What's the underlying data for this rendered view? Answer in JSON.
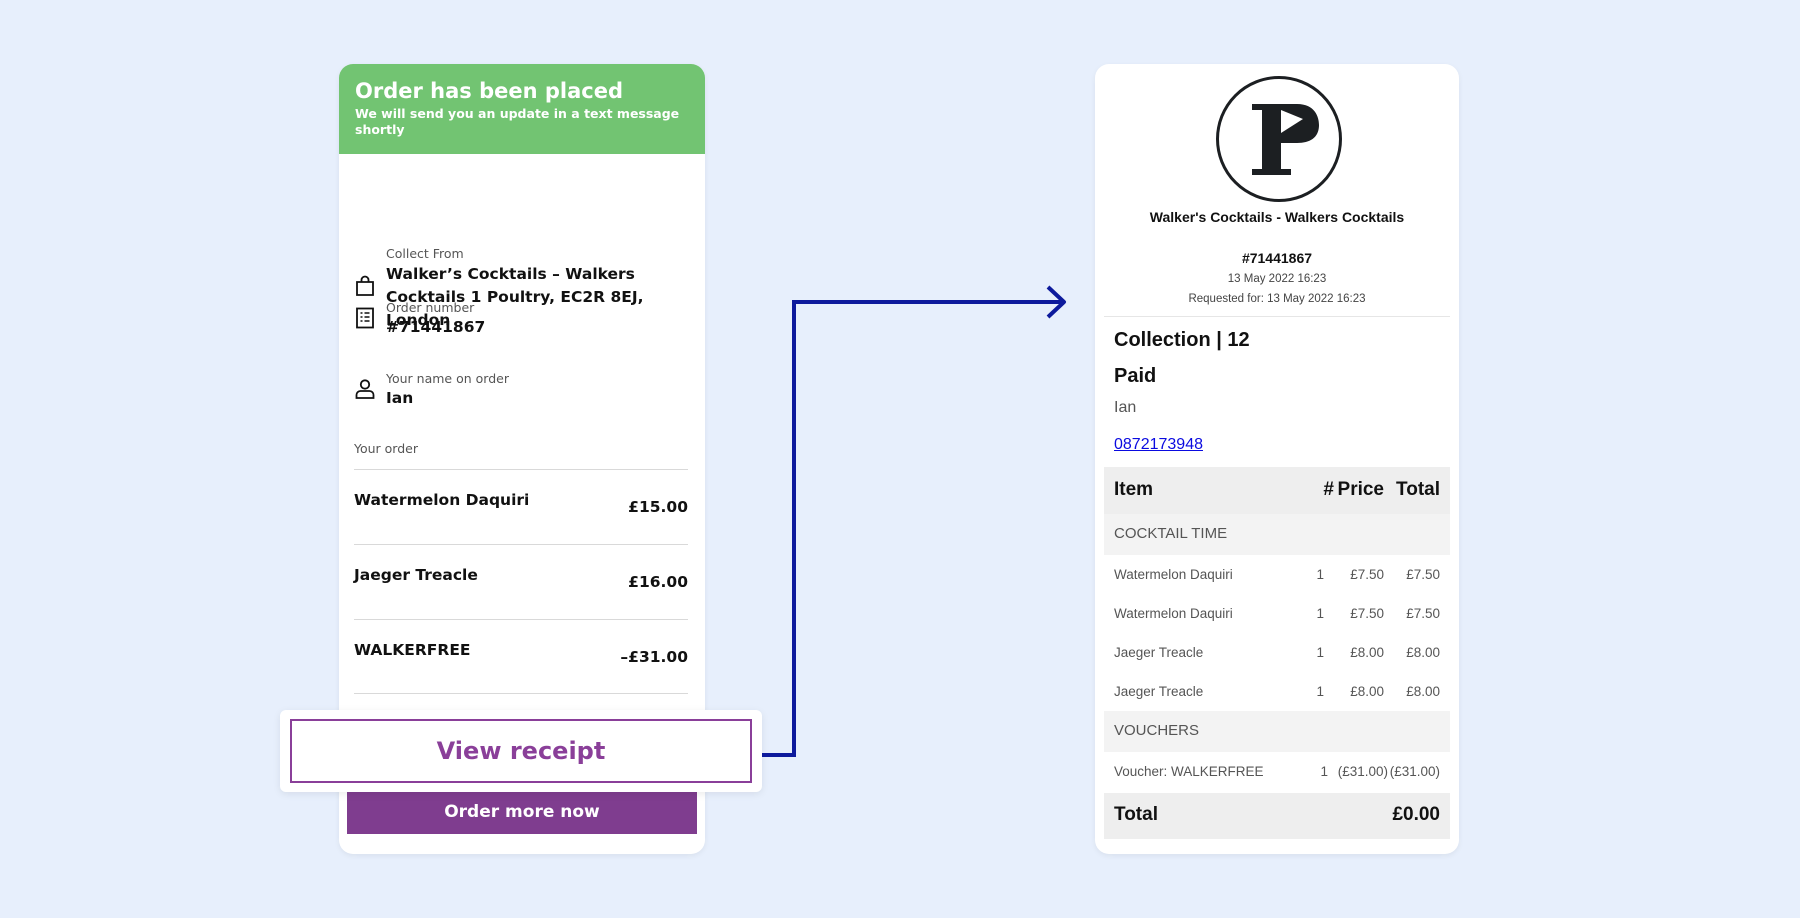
{
  "order_card": {
    "banner_title": "Order has been placed",
    "banner_subtitle": "We will send you an update in a text message shortly",
    "collect_label": "Collect From",
    "collect_value": "Walker’s Cocktails – Walkers Cocktails 1 Poultry, EC2R 8EJ, London",
    "order_number_label": "Order number",
    "order_number_value": "#71441867",
    "name_label": "Your name on order",
    "name_value": "Ian",
    "your_order_label": "Your order",
    "items": [
      {
        "name": "Watermelon Daquiri",
        "price": "£15.00"
      },
      {
        "name": "Jaeger Treacle",
        "price": "£16.00"
      },
      {
        "name": "WALKERFREE",
        "price": "–£31.00"
      }
    ],
    "view_receipt_label": "View receipt",
    "order_more_label": "Order more now",
    "banner_color": "#72c472",
    "accent_color": "#7f3d8f"
  },
  "receipt": {
    "logo_icon": "p-flag-logo",
    "shop_name": "Walker's Cocktails - Walkers Cocktails",
    "order_number": "#71441867",
    "date": "13 May 2022 16:23",
    "requested": "Requested for: 13 May 2022 16:23",
    "collection": "Collection | 12",
    "paid": "Paid",
    "customer_name": "Ian",
    "phone": "0872173948",
    "headers": {
      "item": "Item",
      "qty": "#",
      "price": "Price",
      "total": "Total"
    },
    "category_cocktail": "COCKTAIL TIME",
    "items": [
      {
        "name": "Watermelon Daquiri",
        "qty": "1",
        "price": "£7.50",
        "total": "£7.50"
      },
      {
        "name": "Watermelon Daquiri",
        "qty": "1",
        "price": "£7.50",
        "total": "£7.50"
      },
      {
        "name": "Jaeger Treacle",
        "qty": "1",
        "price": "£8.00",
        "total": "£8.00"
      },
      {
        "name": "Jaeger Treacle",
        "qty": "1",
        "price": "£8.00",
        "total": "£8.00"
      }
    ],
    "category_vouchers": "VOUCHERS",
    "voucher": {
      "name": "Voucher: WALKERFREE",
      "qty": "1",
      "price": "(£31.00)",
      "total": "(£31.00)"
    },
    "total_label": "Total",
    "total_value": "£0.00"
  }
}
